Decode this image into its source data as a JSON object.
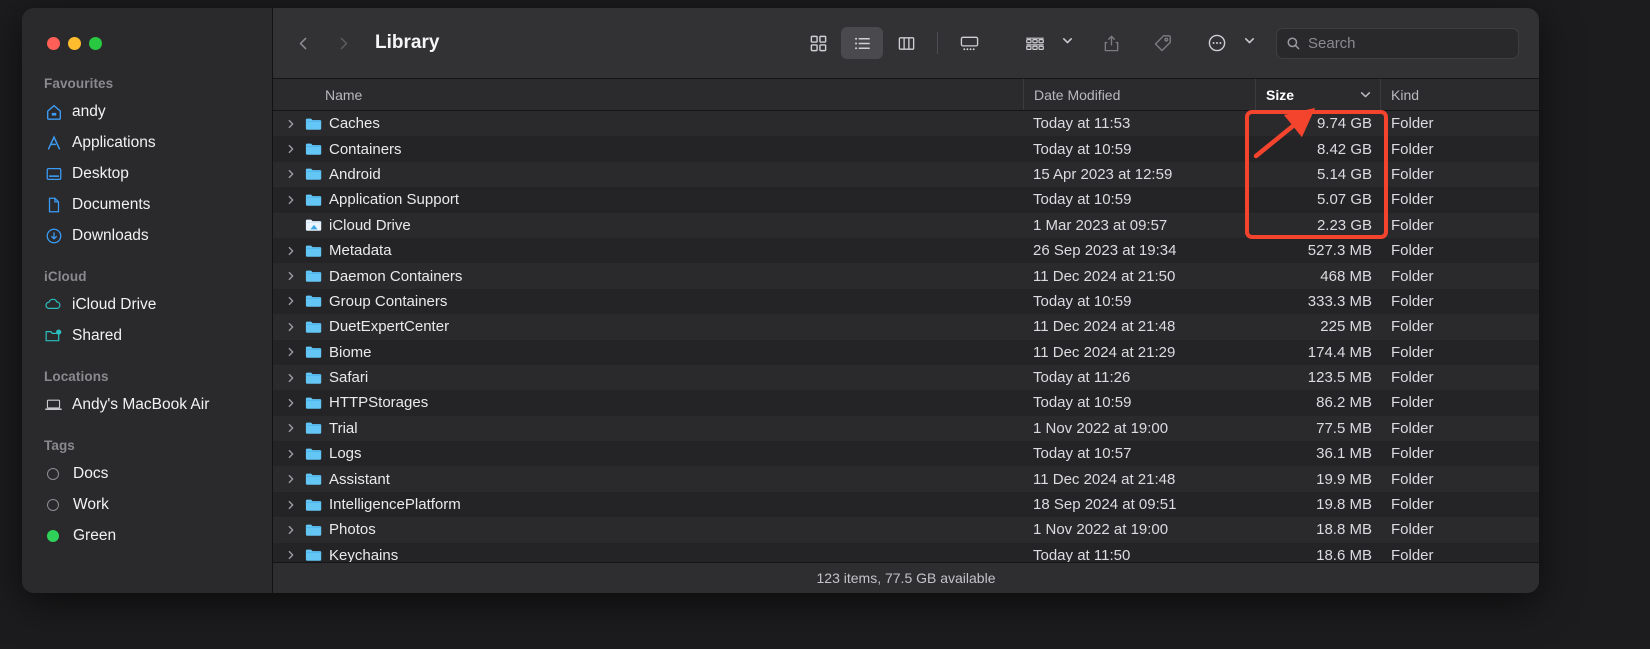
{
  "window": {
    "title": "Library",
    "traffic_lights": [
      "close",
      "minimize",
      "zoom"
    ]
  },
  "toolbar": {
    "back_label": "Back",
    "forward_label": "Forward",
    "icon_view_label": "Icon View",
    "list_view_label": "List View",
    "column_view_label": "Column View",
    "gallery_view_label": "Gallery View",
    "group_label": "Group",
    "share_label": "Share",
    "tags_label": "Tags",
    "more_label": "More"
  },
  "search": {
    "placeholder": "Search",
    "value": ""
  },
  "sidebar": {
    "groups": [
      {
        "title": "Favourites",
        "items": [
          {
            "label": "andy",
            "icon": "home-icon"
          },
          {
            "label": "Applications",
            "icon": "applications-icon"
          },
          {
            "label": "Desktop",
            "icon": "desktop-icon"
          },
          {
            "label": "Documents",
            "icon": "documents-icon"
          },
          {
            "label": "Downloads",
            "icon": "downloads-icon"
          }
        ]
      },
      {
        "title": "iCloud",
        "items": [
          {
            "label": "iCloud Drive",
            "icon": "icloud-drive-icon"
          },
          {
            "label": "Shared",
            "icon": "shared-folder-icon"
          }
        ]
      },
      {
        "title": "Locations",
        "items": [
          {
            "label": "Andy's MacBook Air",
            "icon": "laptop-icon"
          }
        ]
      },
      {
        "title": "Tags",
        "items": [
          {
            "label": "Docs",
            "icon": "tag-dot-icon"
          },
          {
            "label": "Work",
            "icon": "tag-dot-icon"
          },
          {
            "label": "Green",
            "icon": "tag-dot-green-icon"
          }
        ]
      }
    ]
  },
  "columns": {
    "name": "Name",
    "date_modified": "Date Modified",
    "size": "Size",
    "kind": "Kind",
    "sorted_by": "Size"
  },
  "files": [
    {
      "name": "Caches",
      "date": "Today at 11:53",
      "size": "9.74 GB",
      "kind": "Folder",
      "expandable": true,
      "icon": "folder-icon"
    },
    {
      "name": "Containers",
      "date": "Today at 10:59",
      "size": "8.42 GB",
      "kind": "Folder",
      "expandable": true,
      "icon": "folder-icon"
    },
    {
      "name": "Android",
      "date": "15 Apr 2023 at 12:59",
      "size": "5.14 GB",
      "kind": "Folder",
      "expandable": true,
      "icon": "folder-icon"
    },
    {
      "name": "Application Support",
      "date": "Today at 10:59",
      "size": "5.07 GB",
      "kind": "Folder",
      "expandable": true,
      "icon": "folder-icon"
    },
    {
      "name": "iCloud Drive",
      "date": "1 Mar 2023 at 09:57",
      "size": "2.23 GB",
      "kind": "Folder",
      "expandable": false,
      "icon": "icloud-folder-icon"
    },
    {
      "name": "Metadata",
      "date": "26 Sep 2023 at 19:34",
      "size": "527.3 MB",
      "kind": "Folder",
      "expandable": true,
      "icon": "folder-icon"
    },
    {
      "name": "Daemon Containers",
      "date": "11 Dec 2024 at 21:50",
      "size": "468 MB",
      "kind": "Folder",
      "expandable": true,
      "icon": "folder-icon"
    },
    {
      "name": "Group Containers",
      "date": "Today at 10:59",
      "size": "333.3 MB",
      "kind": "Folder",
      "expandable": true,
      "icon": "folder-icon"
    },
    {
      "name": "DuetExpertCenter",
      "date": "11 Dec 2024 at 21:48",
      "size": "225 MB",
      "kind": "Folder",
      "expandable": true,
      "icon": "folder-icon"
    },
    {
      "name": "Biome",
      "date": "11 Dec 2024 at 21:29",
      "size": "174.4 MB",
      "kind": "Folder",
      "expandable": true,
      "icon": "folder-icon"
    },
    {
      "name": "Safari",
      "date": "Today at 11:26",
      "size": "123.5 MB",
      "kind": "Folder",
      "expandable": true,
      "icon": "folder-icon"
    },
    {
      "name": "HTTPStorages",
      "date": "Today at 10:59",
      "size": "86.2 MB",
      "kind": "Folder",
      "expandable": true,
      "icon": "folder-icon"
    },
    {
      "name": "Trial",
      "date": "1 Nov 2022 at 19:00",
      "size": "77.5 MB",
      "kind": "Folder",
      "expandable": true,
      "icon": "folder-icon"
    },
    {
      "name": "Logs",
      "date": "Today at 10:57",
      "size": "36.1 MB",
      "kind": "Folder",
      "expandable": true,
      "icon": "folder-icon"
    },
    {
      "name": "Assistant",
      "date": "11 Dec 2024 at 21:48",
      "size": "19.9 MB",
      "kind": "Folder",
      "expandable": true,
      "icon": "folder-icon"
    },
    {
      "name": "IntelligencePlatform",
      "date": "18 Sep 2024 at 09:51",
      "size": "19.8 MB",
      "kind": "Folder",
      "expandable": true,
      "icon": "folder-icon"
    },
    {
      "name": "Photos",
      "date": "1 Nov 2022 at 19:00",
      "size": "18.8 MB",
      "kind": "Folder",
      "expandable": true,
      "icon": "folder-icon"
    },
    {
      "name": "Keychains",
      "date": "Today at 11:50",
      "size": "18.6 MB",
      "kind": "Folder",
      "expandable": true,
      "icon": "folder-icon"
    }
  ],
  "status_bar": {
    "text": "123 items, 77.5 GB available"
  },
  "annotation": {
    "color": "#f4442e",
    "highlight_target": "size-column-top-five-values",
    "arrow_points_to": "size-column-header"
  }
}
